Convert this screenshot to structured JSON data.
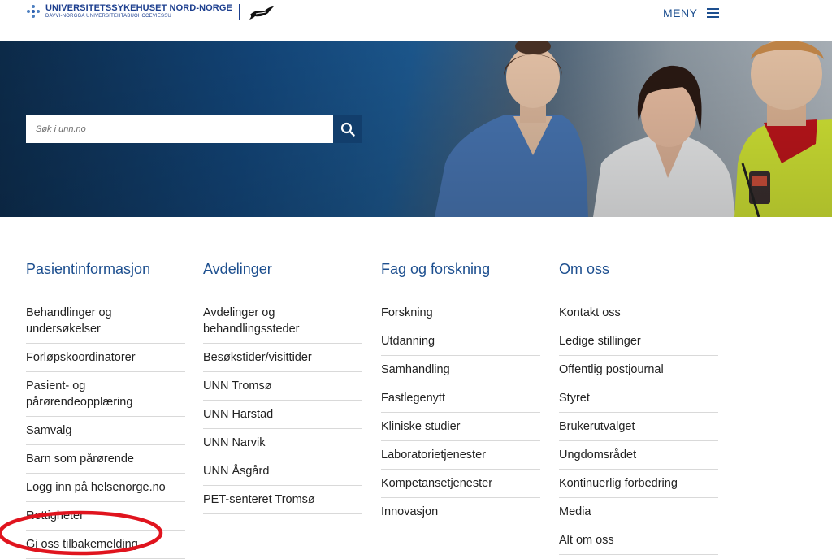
{
  "header": {
    "logo_name": "UNIVERSITETSSYKEHUSET NORD-NORGE",
    "logo_sub": "DAVVI-NORGGA UNIVERSITEHTABUOHCCEVIESSU",
    "menu_label": "MENY",
    "menu_icon": "hamburger-icon",
    "brand_color": "#1d3f8f"
  },
  "hero": {
    "search_placeholder": "Søk i unn.no",
    "search_icon": "search-icon",
    "search_button_color": "#123e6c"
  },
  "columns": [
    {
      "title": "Pasientinformasjon",
      "items": [
        "Behandlinger og undersøkelser",
        "Forløpskoordinatorer",
        "Pasient- og pårørendeopplæring",
        "Samvalg",
        "Barn som pårørende",
        "Logg inn på helsenorge.no",
        "Rettigheter",
        "Gi oss tilbakemelding"
      ]
    },
    {
      "title": "Avdelinger",
      "items": [
        "Avdelinger og behandlingssteder",
        "Besøkstider/visittider",
        "UNN Tromsø",
        "UNN Harstad",
        "UNN Narvik",
        "UNN Åsgård",
        "PET-senteret Tromsø"
      ]
    },
    {
      "title": "Fag og forskning",
      "items": [
        "Forskning",
        "Utdanning",
        "Samhandling",
        "Fastlegenytt",
        "Kliniske studier",
        "Laboratorietjenester",
        "Kompetansetjenester",
        "Innovasjon"
      ]
    },
    {
      "title": "Om oss",
      "items": [
        "Kontakt oss",
        "Ledige stillinger",
        "Offentlig postjournal",
        "Styret",
        "Brukerutvalget",
        "Ungdomsrådet",
        "Kontinuerlig forbedring",
        "Media",
        "Alt om oss"
      ]
    }
  ],
  "annotation": {
    "highlight_color": "#e0141e"
  }
}
